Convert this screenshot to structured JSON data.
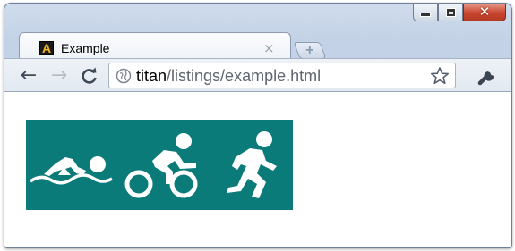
{
  "window": {
    "controls": {
      "minimize": "minimize",
      "maximize": "maximize",
      "close": "close"
    }
  },
  "tab": {
    "title": "Example",
    "favicon_letter": "A",
    "close_glyph": "×",
    "new_tab_glyph": "+"
  },
  "toolbar": {
    "back_glyph": "←",
    "forward_glyph": "→",
    "reload_glyph": "C",
    "url_host": "titan",
    "url_path": "/listings/example.html"
  },
  "content": {
    "sprite_background": "#0a7b78",
    "icons": [
      "swimming-icon",
      "cycling-icon",
      "running-icon"
    ]
  },
  "colors": {
    "sprite_bg": "#0a7b78",
    "close_button": "#c8452f"
  }
}
